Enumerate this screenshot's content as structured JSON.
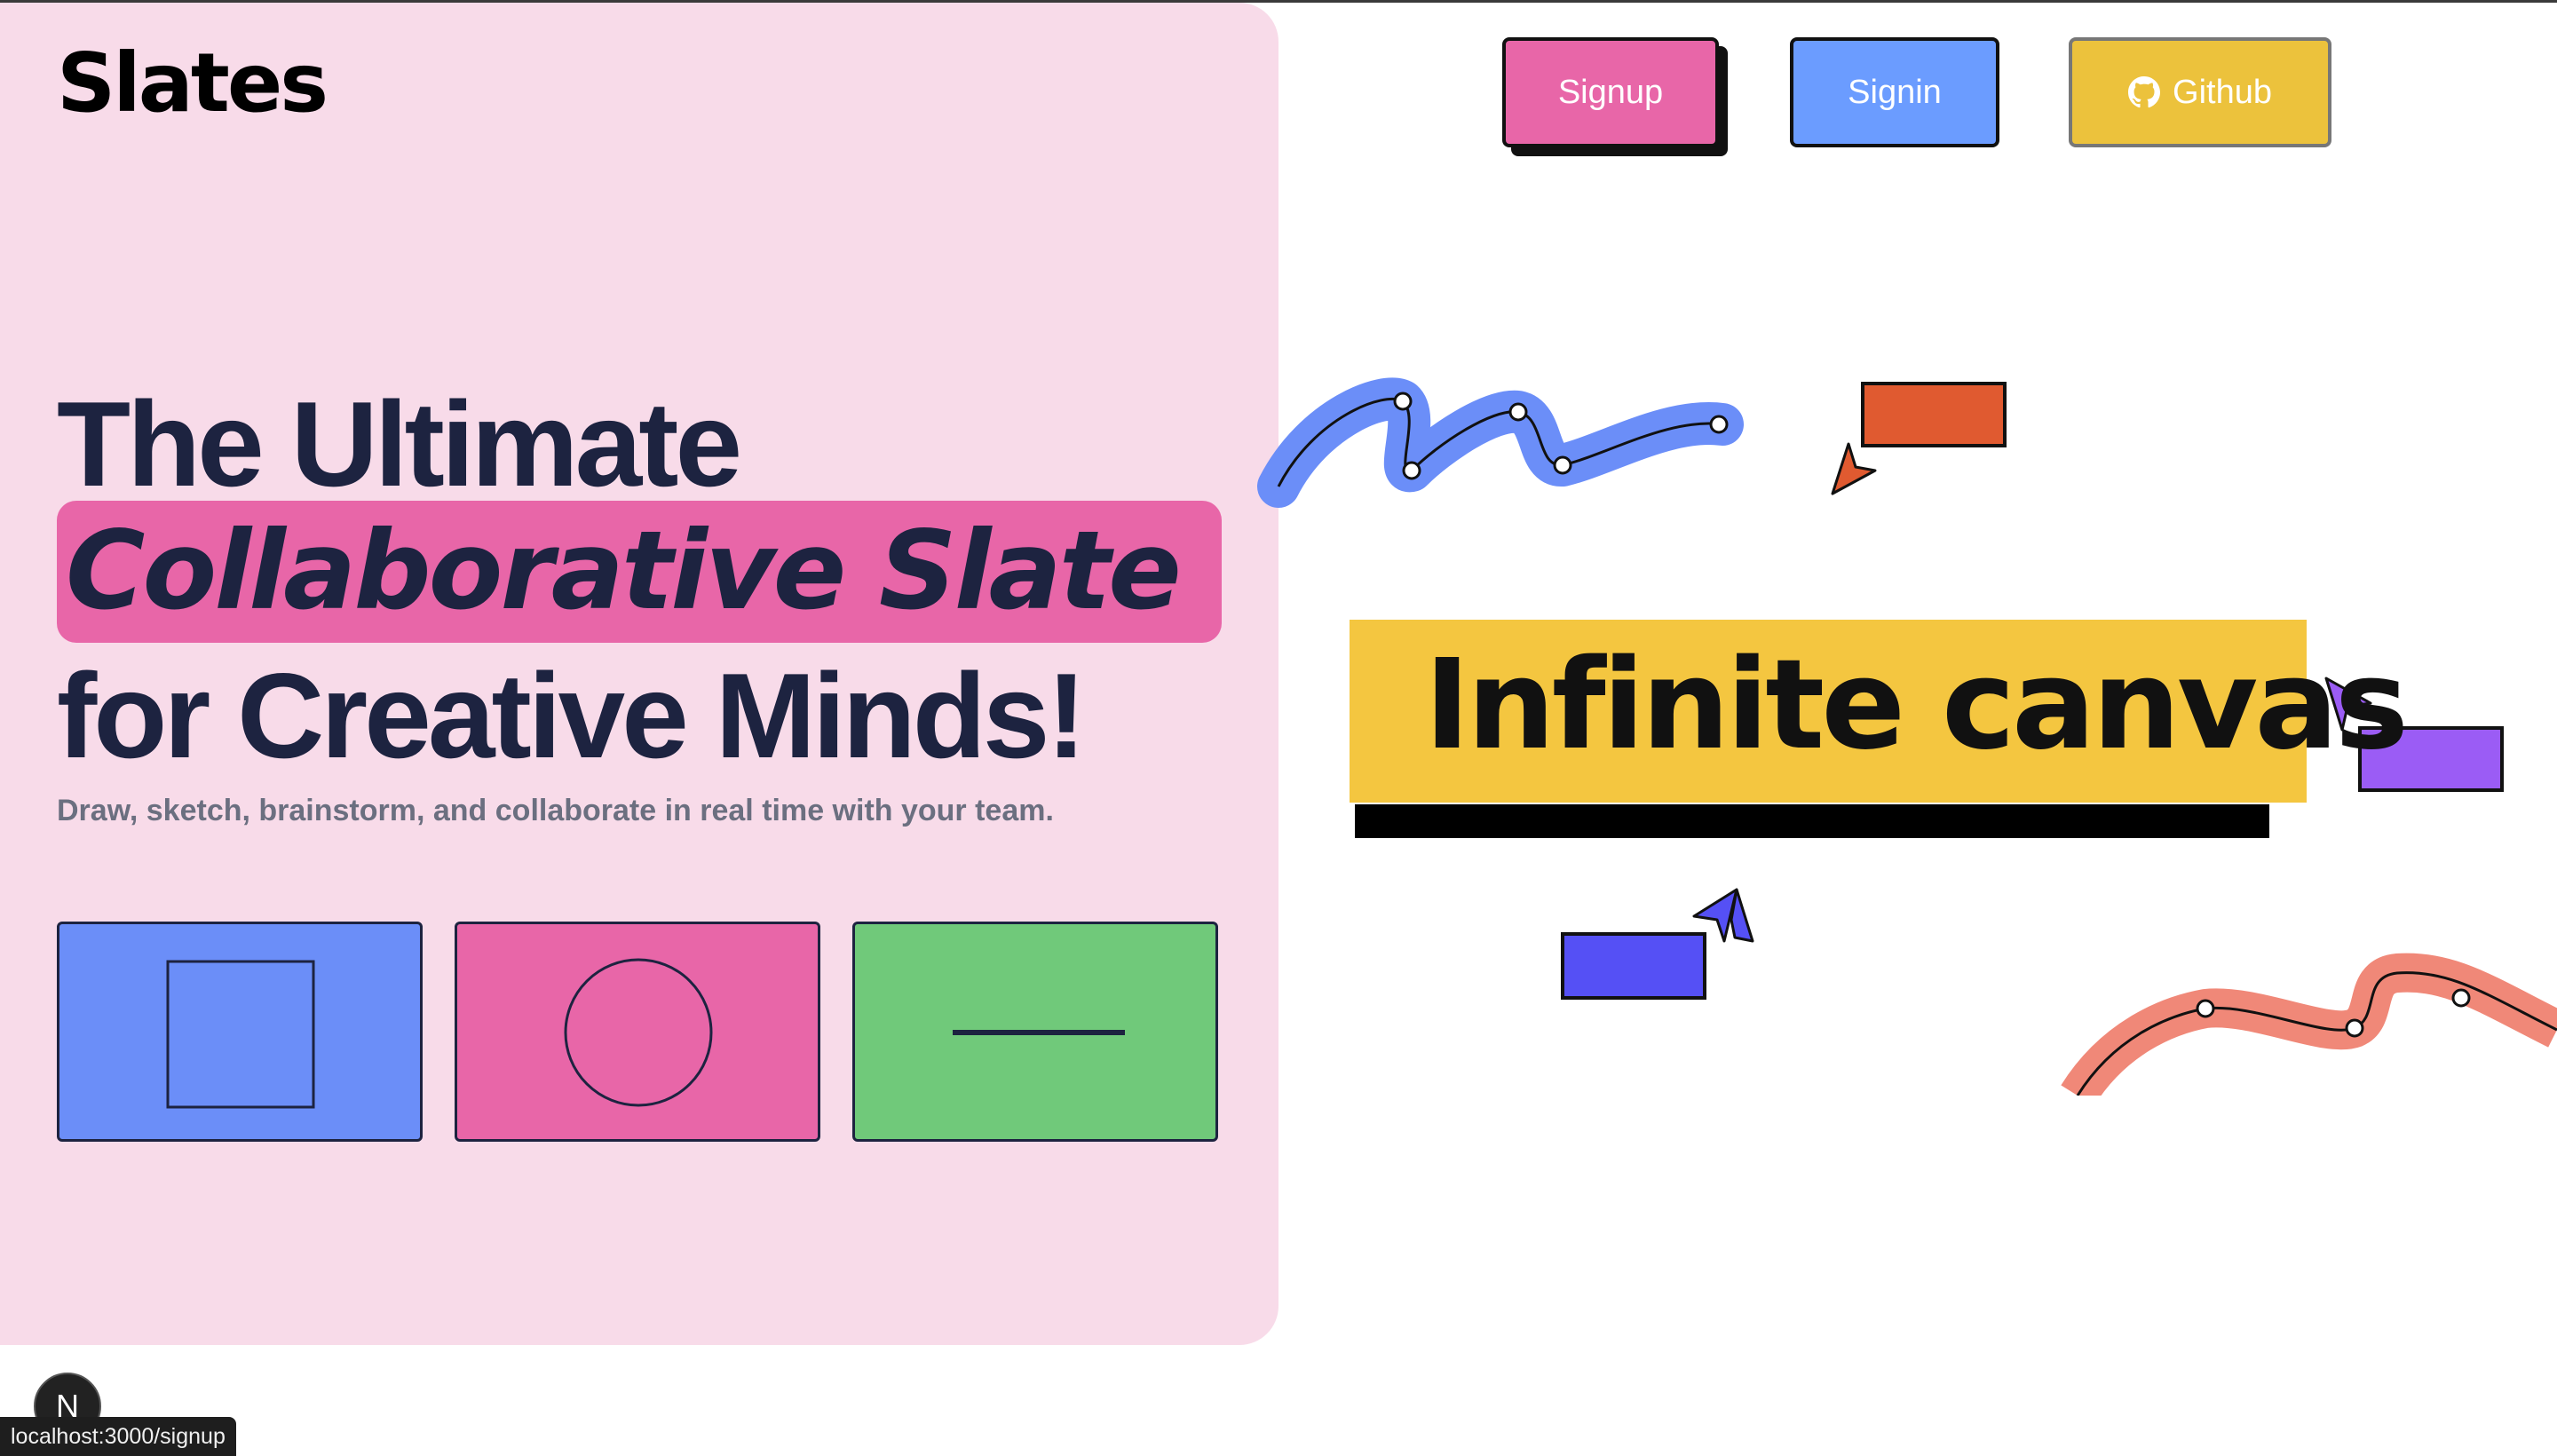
{
  "brand": {
    "logo": "Slates"
  },
  "nav": {
    "signup_label": "Signup",
    "signin_label": "Signin",
    "github_label": "Github"
  },
  "hero": {
    "line1": "The Ultimate",
    "line2": "Collaborative Slate",
    "line3": "for Creative Minds!",
    "subtitle": "Draw, sketch, brainstorm, and collaborate in real time with your team."
  },
  "tools": [
    {
      "shape": "rectangle",
      "icon": "square-icon",
      "color": "#6b8ef8"
    },
    {
      "shape": "circle",
      "icon": "circle-icon",
      "color": "#e866a8"
    },
    {
      "shape": "line",
      "icon": "line-icon",
      "color": "#70c97a"
    }
  ],
  "canvas_banner": {
    "text": "Infinite canvas"
  },
  "status_bar": {
    "url": "localhost:3000/signup"
  },
  "dev_badge": {
    "letter": "N"
  },
  "colors": {
    "hero_bg": "#f8dbe9",
    "pink": "#e866a8",
    "blue": "#6b9cff",
    "yellow": "#ecc23c",
    "green": "#70c97a",
    "orange": "#e05a30",
    "purple": "#9b5cf5",
    "indigo": "#5550f5",
    "salmon": "#f08878",
    "navy": "#1d2340"
  }
}
